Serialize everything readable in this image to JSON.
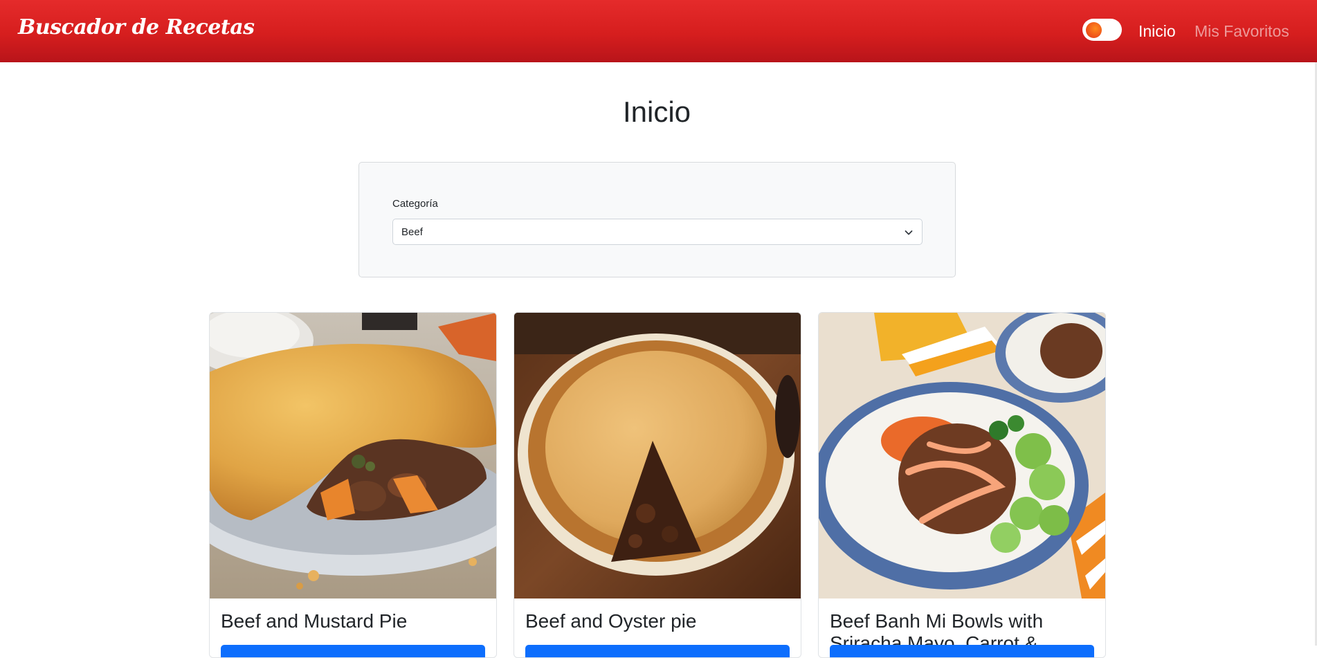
{
  "navbar": {
    "brand": "Buscador de Recetas",
    "links": [
      {
        "label": "Inicio",
        "active": true
      },
      {
        "label": "Mis Favoritos",
        "active": false
      }
    ],
    "theme_toggle": {
      "icon": "theme-toggle-icon",
      "on": false
    }
  },
  "main": {
    "title": "Inicio",
    "filter": {
      "category_label": "Categoría",
      "category_value": "Beef"
    },
    "recipes": [
      {
        "title": "Beef and Mustard Pie",
        "image": "beef-mustard-pie-photo"
      },
      {
        "title": "Beef and Oyster pie",
        "image": "beef-oyster-pie-photo"
      },
      {
        "title": "Beef Banh Mi Bowls with Sriracha Mayo, Carrot &",
        "image": "beef-banh-mi-bowl-photo"
      }
    ]
  },
  "colors": {
    "navbar_red": "#d61e1e",
    "primary_button": "#0d6efd",
    "panel_bg": "#f8f9fa"
  }
}
